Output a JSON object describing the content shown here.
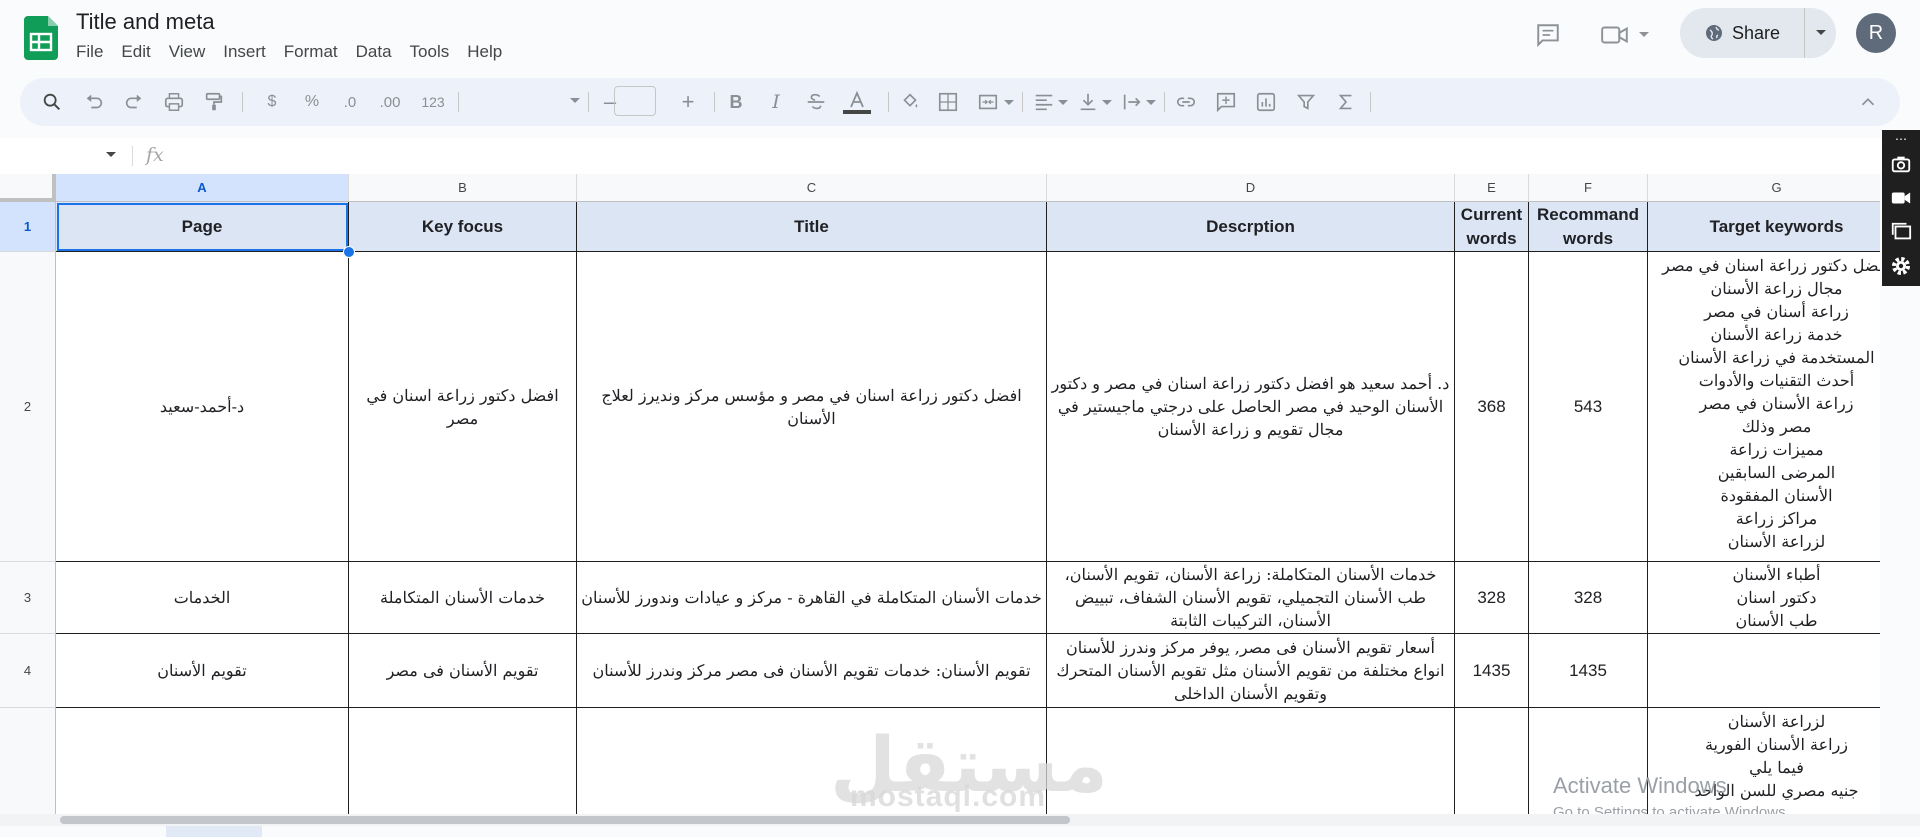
{
  "app": {
    "doc_title": "Title and meta",
    "menu": [
      "File",
      "Edit",
      "View",
      "Insert",
      "Format",
      "Data",
      "Tools",
      "Help"
    ],
    "share_label": "Share",
    "avatar_letter": "R",
    "brand_color": "#0f9d58"
  },
  "formula": {
    "fx_label": "fx",
    "value": ""
  },
  "toolbar": {
    "currency": "$",
    "percent": "%",
    "decimal_decrease": ".0",
    "decimal_increase": ".00",
    "number_format": "123",
    "font_minus": "–",
    "font_plus": "+",
    "bold": "B",
    "italic": "I"
  },
  "columns": [
    "A",
    "B",
    "C",
    "D",
    "E",
    "F",
    "G"
  ],
  "rows": [
    "1",
    "2",
    "3",
    "4",
    ""
  ],
  "header": {
    "page": "Page",
    "key_focus": "Key focus",
    "title": "Title",
    "description": "Descrption",
    "current_words": "Current words",
    "recommand_words": "Recommand words",
    "target_keywords": "Target keywords"
  },
  "data": [
    {
      "page": "د-أحمد-سعيد",
      "key_focus": "افضل دكتور زراعة اسنان في مصر",
      "title": "افضل دكتور زراعة اسنان في مصر و مؤسس مركز ونديرز لعلاج الأسنان",
      "description": "د. أحمد سعيد هو افضل دكتور زراعة اسنان في مصر و دكتور الأسنان الوحيد في مصر الحاصل على درجتي ماجيستير في مجال تقويم و زراعة الأسنان",
      "current": "368",
      "recommand": "543",
      "keywords": [
        "افضل دكتور زراعة اسنان في مصر",
        "مجال زراعة الأسنان",
        "زراعة أسنان في مصر",
        "خدمة زراعة الأسنان",
        "المستخدمة في زراعة الأسنان",
        "أحدث التقنيات والأدوات",
        "زراعة الأسنان في مصر",
        "مصر وذلك",
        "مميزات زراعة",
        "المرضى السابقين",
        "الأسنان المفقودة",
        "مراكز زراعة",
        "لزراعة الأسنان"
      ]
    },
    {
      "page": "الخدمات",
      "key_focus": "خدمات الأسنان المتكاملة",
      "title": "خدمات الأسنان المتكاملة في القاهرة - مركز و عيادات وندورز للأسنان",
      "description": "خدمات الأسنان المتكاملة: زراعة الأسنان، تقويم الأسنان، طب الأسنان التجميلي، تقويم الأسنان الشفاف، تبييض الأسنان، التركيبات الثابتة",
      "current": "328",
      "recommand": "328",
      "keywords": [
        "أطباء الأسنان",
        "دكتور اسنان",
        "طب الأسنان"
      ]
    },
    {
      "page": "تقويم الأسنان",
      "key_focus": "تقويم الأسنان فى مصر",
      "title": "تقويم الأسنان: خدمات تقويم الأسنان فى مصر مركز وندرز للأسنان",
      "description": "أسعار تقويم الأسنان فى مصر, يوفر مركز وندرز للأسنان انواع مختلفة من تقويم الأسنان مثل تقويم الأسنان المتحرك وتقويم الأسنان الداخلى",
      "current": "1435",
      "recommand": "1435",
      "keywords": []
    },
    {
      "page": "",
      "key_focus": "",
      "title": "",
      "description": "",
      "current": "",
      "recommand": "",
      "keywords": [
        "لزراعة الأسنان",
        "زراعة الأسنان الفورية",
        "فيما يلي",
        "جنيه مصري للسن الواحد"
      ]
    }
  ],
  "overlay": {
    "watermark_ar": "مستقل",
    "watermark_en": "mostaql.com",
    "activate_title": "Activate Windows",
    "activate_sub": "Go to Settings to activate Windows."
  }
}
